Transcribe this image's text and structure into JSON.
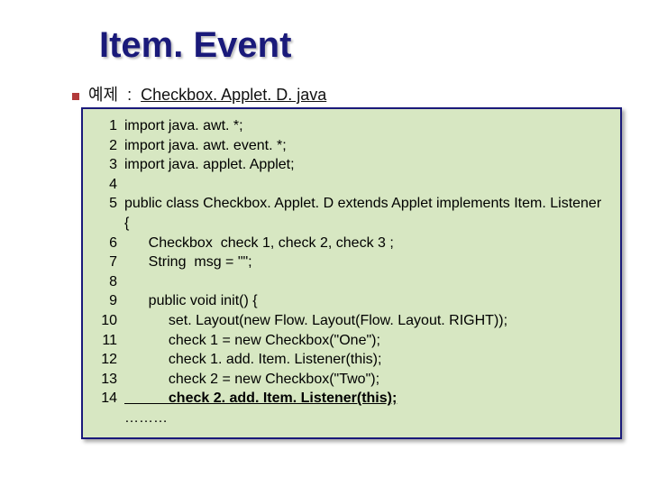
{
  "title": "Item. Event",
  "example": {
    "label": "예제  :  ",
    "filename": "Checkbox. Applet. D. java"
  },
  "code": {
    "lines": [
      {
        "n": "1",
        "text": "import java. awt. *;"
      },
      {
        "n": "2",
        "text": "import java. awt. event. *;"
      },
      {
        "n": "3",
        "text": "import java. applet. Applet;"
      },
      {
        "n": "4",
        "text": ""
      },
      {
        "n": "5",
        "text": "public class Checkbox. Applet. D extends Applet implements Item. Listener"
      },
      {
        "n": "",
        "text": "{"
      },
      {
        "n": "6",
        "text": "      Checkbox  check 1, check 2, check 3 ;"
      },
      {
        "n": "7",
        "text": "      String  msg = \"\";"
      },
      {
        "n": "8",
        "text": ""
      },
      {
        "n": "9",
        "text": "      public void init() {"
      },
      {
        "n": "10",
        "text": "           set. Layout(new Flow. Layout(Flow. Layout. RIGHT));"
      },
      {
        "n": "11",
        "text": "           check 1 = new Checkbox(\"One\");"
      },
      {
        "n": "12",
        "text": "           check 1. add. Item. Listener(this);"
      },
      {
        "n": "13",
        "text": "           check 2 = new Checkbox(\"Two\");"
      },
      {
        "n": "14",
        "text": "           check 2. add. Item. Listener(this);",
        "underline": true
      }
    ],
    "ellipsis": "………"
  }
}
